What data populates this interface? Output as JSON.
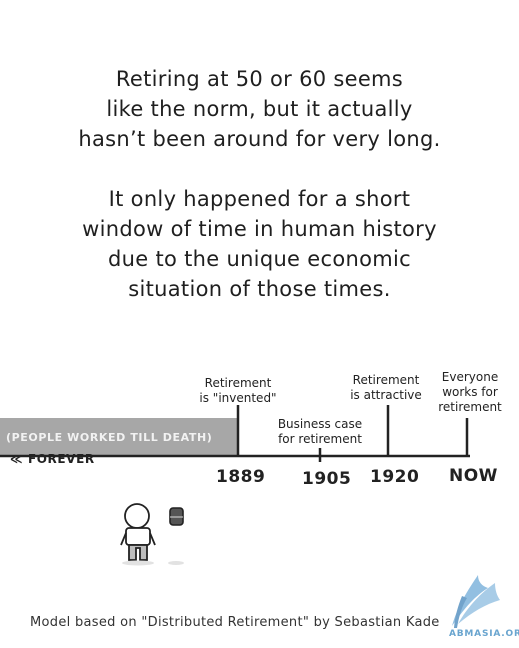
{
  "intro": {
    "paragraph1": [
      "Retiring at 50 or 60 seems",
      "like the norm, but it actually",
      "hasn’t been around for very long."
    ],
    "paragraph2": [
      "It only happened for a short",
      "window of time in human history",
      "due to the unique economic",
      "situation of those times."
    ]
  },
  "timeline": {
    "band_text": "(PEOPLE WORKED TILL DEATH)",
    "forever": "≪ FOREVER",
    "events": [
      {
        "year": "1889",
        "label": [
          "Retirement",
          "is \"invented\""
        ]
      },
      {
        "year": "1905",
        "label": [
          "Business case",
          "for retirement"
        ]
      },
      {
        "year": "1920",
        "label": [
          "Retirement",
          "is attractive"
        ]
      },
      {
        "year": "NOW",
        "label": [
          "Everyone",
          "works for",
          "retirement"
        ]
      }
    ]
  },
  "footer": "Model based on \"Distributed Retirement\" by Sebastian Kade",
  "watermark": {
    "text": "ABMASIA.ORG",
    "color": "#6aa5cf"
  }
}
